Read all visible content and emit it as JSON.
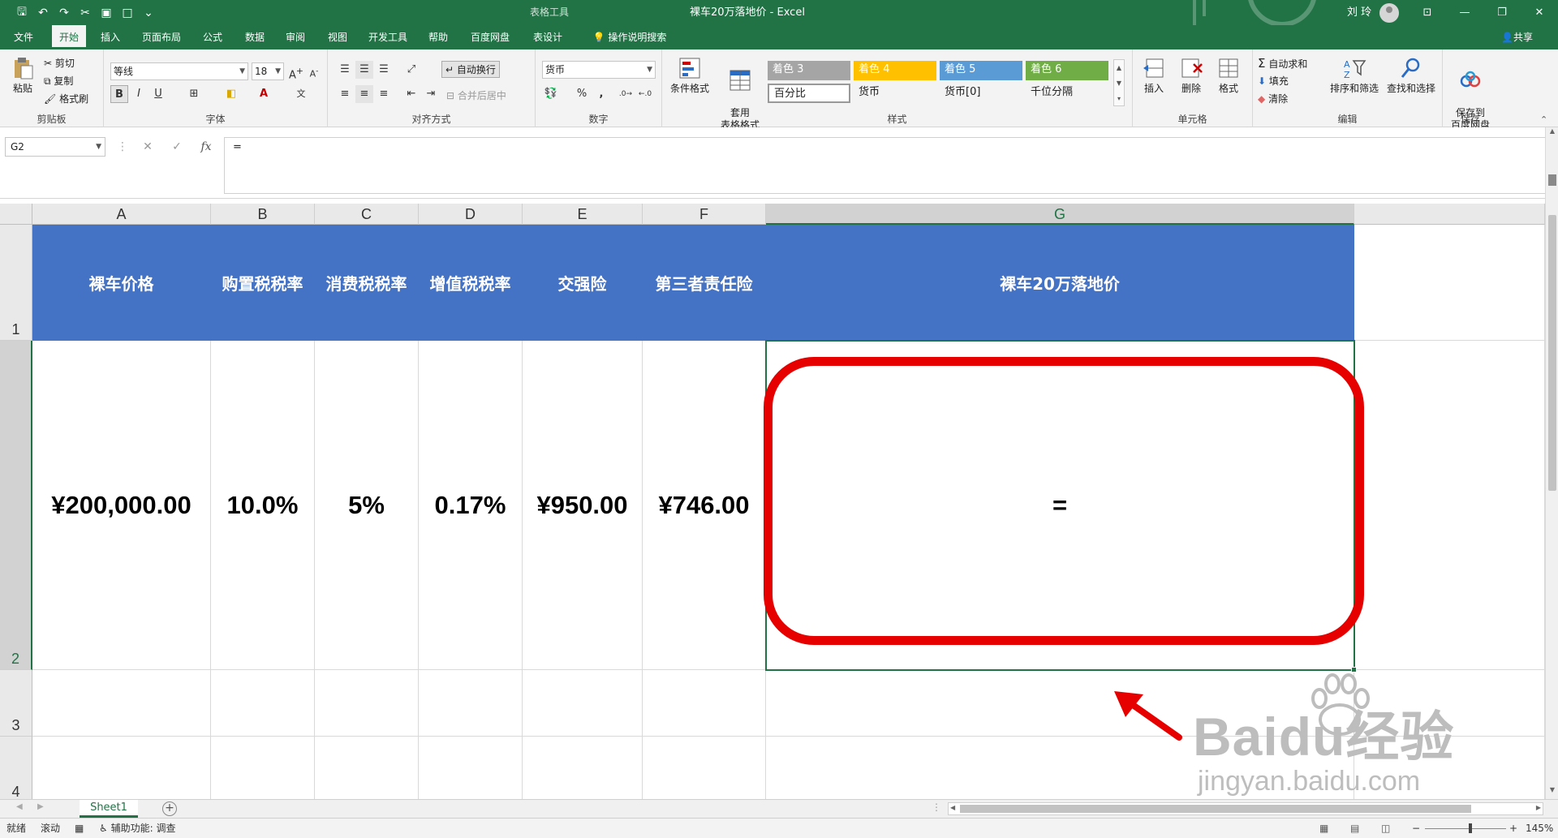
{
  "titlebar": {
    "context_group": "表格工具",
    "title": "裸车20万落地价  -  Excel",
    "user": "刘 玲",
    "minimize": "—",
    "restore": "❐",
    "close": "✕"
  },
  "tabs": [
    "文件",
    "开始",
    "插入",
    "页面布局",
    "公式",
    "数据",
    "审阅",
    "视图",
    "开发工具",
    "帮助",
    "百度网盘",
    "表设计",
    "操作说明搜索"
  ],
  "share_label": "共享",
  "ribbon": {
    "clipboard": {
      "paste": "粘贴",
      "cut": "剪切",
      "copy": "复制",
      "format_painter": "格式刷",
      "label": "剪贴板"
    },
    "font": {
      "name": "等线",
      "size": "18",
      "bold": "B",
      "italic": "I",
      "underline": "U",
      "label": "字体"
    },
    "alignment": {
      "wrap": "自动换行",
      "merge": "合并后居中",
      "label": "对齐方式"
    },
    "number": {
      "format": "货币",
      "percent": "%",
      "comma": ",",
      "label": "数字"
    },
    "styles": {
      "conditional": "条件格式",
      "table_format": "套用\n表格格式",
      "items": [
        "着色 3",
        "着色 4",
        "着色 5",
        "着色 6",
        "百分比",
        "货币",
        "货币[0]",
        "千位分隔"
      ],
      "label": "样式"
    },
    "cells": {
      "insert": "插入",
      "delete": "删除",
      "format": "格式",
      "label": "单元格"
    },
    "editing": {
      "autosum": "自动求和",
      "fill": "填充",
      "clear": "清除",
      "sort": "排序和筛选",
      "find": "查找和选择",
      "label": "编辑"
    },
    "save": {
      "button": "保存到\n百度网盘",
      "label": "保存"
    }
  },
  "formula_bar": {
    "name_box": "G2",
    "cancel": "✕",
    "enter": "✓",
    "fx": "fx",
    "content": "="
  },
  "grid": {
    "columns": [
      "A",
      "B",
      "C",
      "D",
      "E",
      "F",
      "G"
    ],
    "rows": [
      "1",
      "2",
      "3",
      "4"
    ],
    "header_row": [
      "裸车价格",
      "购置税税率",
      "消费税税率",
      "增值税税率",
      "交强险",
      "第三者责任险",
      "裸车20万落地价"
    ],
    "data_row": [
      "¥200,000.00",
      "10.0%",
      "5%",
      "0.17%",
      "¥950.00",
      "¥746.00",
      "="
    ]
  },
  "watermark": {
    "main": "Baidu经验",
    "sub": "jingyan.baidu.com"
  },
  "sheet_tab": "Sheet1",
  "status": {
    "ready": "就绪",
    "scroll": "滚动",
    "accessibility": "辅助功能: 调查",
    "zoom": "145%"
  },
  "colors": {
    "excel_green": "#217346",
    "header_blue": "#4472c4",
    "highlight_red": "#e60000"
  }
}
